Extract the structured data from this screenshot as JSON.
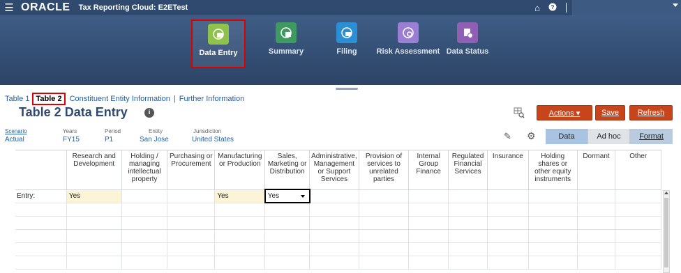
{
  "header": {
    "brand": "ORACLE",
    "app_title": "Tax Reporting Cloud: E2ETest",
    "home_icon": "home-icon",
    "help_icon": "help-icon"
  },
  "nav": {
    "items": [
      {
        "label": "Data Entry",
        "icon": "data-entry-icon",
        "color": "#8fc24a",
        "selected": true
      },
      {
        "label": "Summary",
        "icon": "summary-icon",
        "color": "#3f9a62"
      },
      {
        "label": "Filing",
        "icon": "filing-icon",
        "color": "#2b8fd6"
      },
      {
        "label": "Risk Assessment",
        "icon": "risk-assessment-icon",
        "color": "#9b7fd4"
      },
      {
        "label": "Data Status",
        "icon": "data-status-icon",
        "color": "#8e5fb3"
      }
    ]
  },
  "tabs": {
    "t1": "Table 1",
    "t2": "Table 2",
    "t3": "Constituent Entity Information",
    "t4": "Further Information",
    "sep": "|"
  },
  "page": {
    "title": "Table 2 Data Entry",
    "info": "i"
  },
  "toolbar": {
    "actions": "Actions ▾",
    "save": "Save",
    "refresh": "Refresh",
    "data": "Data",
    "adhoc": "Ad hoc",
    "format": "Format"
  },
  "pov": {
    "scenario_label": "Scenario",
    "scenario": "Actual",
    "years_label": "Years",
    "years": "FY15",
    "period_label": "Period",
    "period": "P1",
    "entity_label": "Entity",
    "entity": "San Jose",
    "jurisdiction_label": "Jurisdiction",
    "jurisdiction": "United States"
  },
  "grid": {
    "columns": [
      "Research and Development",
      "Holding / managing intellectual property",
      "Purchasing or Procurement",
      "Manufacturing or Production",
      "Sales, Marketing or Distribution",
      "Administrative, Management or Support Services",
      "Provision of services to unrelated parties",
      "Internal Group Finance",
      "Regulated Financial Services",
      "Insurance",
      "Holding shares or other equity instruments",
      "Dormant",
      "Other"
    ],
    "row_label": "Entry:",
    "values": [
      "Yes",
      "",
      "",
      "Yes",
      "Yes",
      "",
      "",
      "",
      "",
      "",
      "",
      "",
      ""
    ]
  },
  "colors": {
    "top_bar": "#2f4a6e",
    "accent_button": "#c8441a",
    "selection_outline": "#d00000"
  }
}
